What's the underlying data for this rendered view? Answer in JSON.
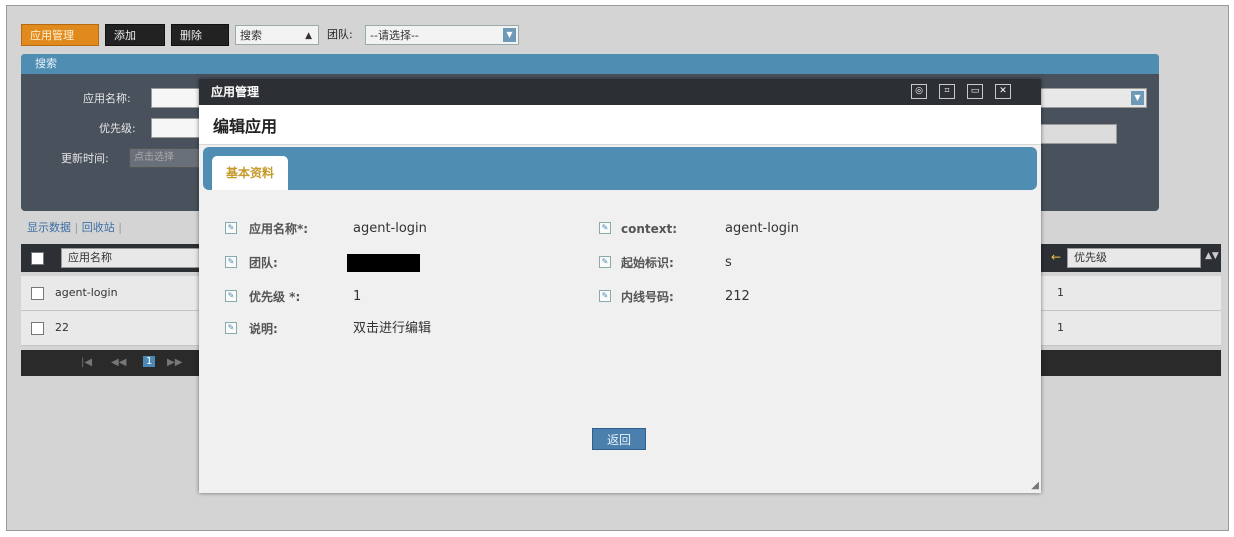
{
  "toolbar": {
    "active_tab": "应用管理",
    "add_label": "添加",
    "delete_label": "删除",
    "search_select": "搜索",
    "team_label": "团队:",
    "team_select": "--请选择--"
  },
  "search_panel": {
    "header": "搜索",
    "app_name_label": "应用名称:",
    "priority_label": "优先级:",
    "update_time_label": "更新时间:",
    "update_time_placeholder": "点击选择"
  },
  "list_links": {
    "show_data": "显示数据",
    "recycle": "回收站"
  },
  "grid": {
    "column_app_name": "应用名称",
    "column_priority": "优先级",
    "rows": [
      {
        "name": "agent-login",
        "priority": "1"
      },
      {
        "name": "22",
        "priority": "1"
      }
    ],
    "current_page": "1"
  },
  "modal": {
    "title": "应用管理",
    "subtitle": "编辑应用",
    "tab_basic": "基本资料",
    "fields": {
      "app_name_label": "应用名称*:",
      "app_name_value": "agent-login",
      "team_label": "团队:",
      "priority_label": "优先级 *:",
      "priority_value": "1",
      "description_label": "说明:",
      "description_value": "双击进行编辑",
      "context_label": "context:",
      "context_value": "agent-login",
      "start_marker_label": "起始标识:",
      "start_marker_value": "s",
      "extension_label": "内线号码:",
      "extension_value": "212"
    },
    "return_button": "返回"
  },
  "colors": {
    "accent_blue": "#4f8db3",
    "dark_bar": "#2c2f33",
    "tab_text": "#c69a2a",
    "orange_tab": "#e08a1e"
  }
}
